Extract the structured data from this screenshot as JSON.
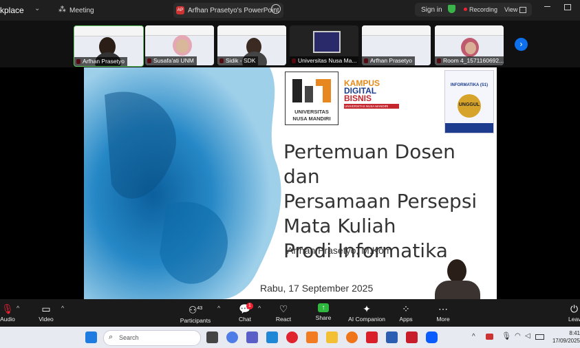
{
  "window": {
    "app_fragment": "kplace",
    "meeting_label": "Meeting",
    "presenter_badge": "AP",
    "share_title": "Arfhan Prasetyo's PowerPoint",
    "sign_in": "Sign in",
    "recording": "Recording",
    "view": "View"
  },
  "participants_strip": [
    {
      "name": "Arfhan Prasetyo"
    },
    {
      "name": "Susafa'ati UNM"
    },
    {
      "name": "Sidik - SDK"
    },
    {
      "name": "Universitas Nusa Ma..."
    },
    {
      "name": "Arfhan Prasetyo"
    },
    {
      "name": "Room 4_1571160692..."
    }
  ],
  "slide": {
    "logo_text_line1": "UNIVERSITAS",
    "logo_text_line2": "NUSA MANDIRI",
    "kampus_line1": "KAMPUS",
    "kampus_line2": "DIGITAL",
    "kampus_line3": "BISNIS",
    "kampus_sub": "UNIVERSITAS NUSA MANDIRI",
    "badge_top": "INFORMATIKA (S1)",
    "badge_unggul": "UNGGUL",
    "title_lines": [
      "Pertemuan Dosen dan",
      "Persamaan Persepsi",
      "Mata Kuliah",
      "Prodi Informatika"
    ],
    "presenter": "Arfhan Prasetyo, M.Kom",
    "date": "Rabu, 17 September 2025"
  },
  "toolbar": {
    "audio": "Audio",
    "video": "Video",
    "participants": "Participants",
    "participants_count": "43",
    "chat": "Chat",
    "chat_badge": "1",
    "react": "React",
    "share": "Share",
    "ai": "AI Companion",
    "apps": "Apps",
    "more": "More",
    "leave": "Leave"
  },
  "taskbar": {
    "search_placeholder": "Search",
    "time": "8:41",
    "date": "17/09/2025"
  }
}
